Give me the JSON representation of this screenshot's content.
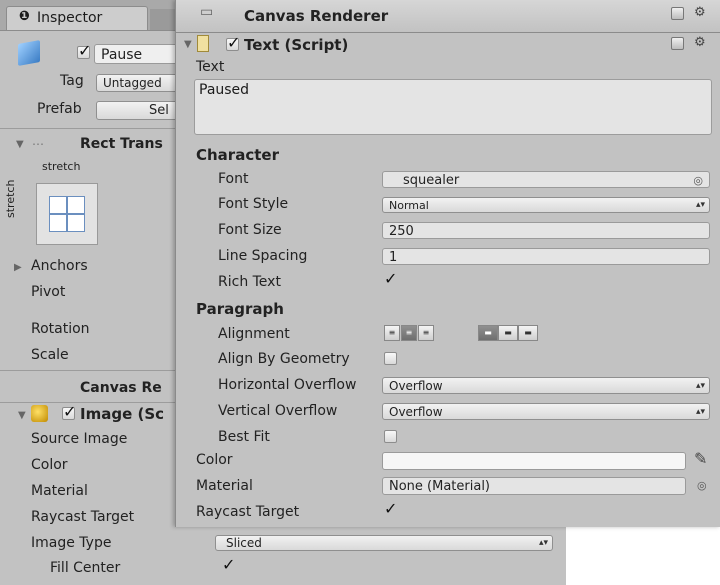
{
  "inspector": {
    "tab_label": "Inspector",
    "object_name": "Pause",
    "tag_label": "Tag",
    "tag_value": "Untagged",
    "prefab_label": "Prefab",
    "prefab_button": "Sel",
    "rect_transform_title": "Rect Trans",
    "anchor_top_label": "stretch",
    "anchor_side_label": "stretch",
    "rows": [
      "Anchors",
      "Pivot",
      "Rotation",
      "Scale"
    ],
    "canvas_renderer_title": "Canvas Re",
    "image_title": "Image (Sc",
    "image_fields": {
      "source_image": "Source Image",
      "color": "Color",
      "material": "Material",
      "raycast": "Raycast Target",
      "image_type": "Image Type",
      "fill_center": "Fill Center"
    },
    "image_type_value": "Sliced"
  },
  "text_panel": {
    "canvas_renderer_title": "Canvas Renderer",
    "component_title": "Text (Script)",
    "text_label": "Text",
    "text_value": "Paused",
    "character_header": "Character",
    "font_label": "Font",
    "font_value": "squealer",
    "font_style_label": "Font Style",
    "font_style_value": "Normal",
    "font_size_label": "Font Size",
    "font_size_value": "250",
    "line_spacing_label": "Line Spacing",
    "line_spacing_value": "1",
    "rich_text_label": "Rich Text",
    "paragraph_header": "Paragraph",
    "alignment_label": "Alignment",
    "align_geometry_label": "Align By Geometry",
    "h_overflow_label": "Horizontal Overflow",
    "h_overflow_value": "Overflow",
    "v_overflow_label": "Vertical Overflow",
    "v_overflow_value": "Overflow",
    "best_fit_label": "Best Fit",
    "color_label": "Color",
    "material_label": "Material",
    "material_value": "None (Material)",
    "raycast_label": "Raycast Target"
  },
  "colors": {
    "panel_bg": "#c2c2c2",
    "header_bg": "#cacaca",
    "field_bg": "#e4e4e4",
    "color_swatch": "#f6f6f6"
  },
  "icons": [
    "inspector-info-icon",
    "cube-icon",
    "triangle-icon",
    "canvas-icon",
    "image-icon",
    "eyedropper-icon",
    "settings-gear-icon",
    "book-icon",
    "object-picker-icon"
  ]
}
